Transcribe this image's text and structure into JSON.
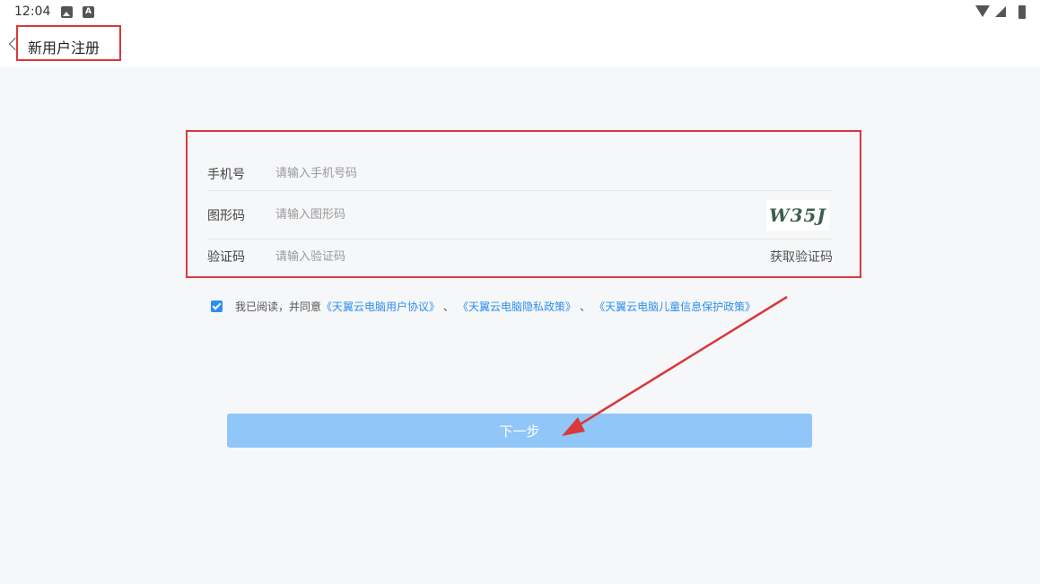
{
  "status_bar": {
    "time": "12:04",
    "left_icons": [
      "gallery-icon",
      "a-icon"
    ],
    "a_icon_letter": "A",
    "right_icons": [
      "wifi-icon",
      "signal-icon",
      "battery-icon"
    ]
  },
  "header": {
    "back_icon": "chevron-left-icon",
    "title": "新用户注册"
  },
  "form": {
    "phone": {
      "label": "手机号",
      "placeholder": "请输入手机号码",
      "value": ""
    },
    "captcha": {
      "label": "图形码",
      "placeholder": "请输入图形码",
      "value": "",
      "image_text": "W35J"
    },
    "sms_code": {
      "label": "验证码",
      "placeholder": "请输入验证码",
      "value": "",
      "action_label": "获取验证码"
    }
  },
  "agreement": {
    "checked": true,
    "prefix": "我已阅读，并同意",
    "link1": "《天翼云电脑用户协议》",
    "sep1": "、",
    "link2": "《天翼云电脑隐私政策》",
    "sep2": "、",
    "link3": "《天翼云电脑儿童信息保护政策》"
  },
  "next_button": {
    "label": "下一步"
  },
  "colors": {
    "primary": "#2d8ef0",
    "button_disabled": "#90c6f8",
    "annotation": "#d9383c",
    "background": "#f6f7f9"
  }
}
